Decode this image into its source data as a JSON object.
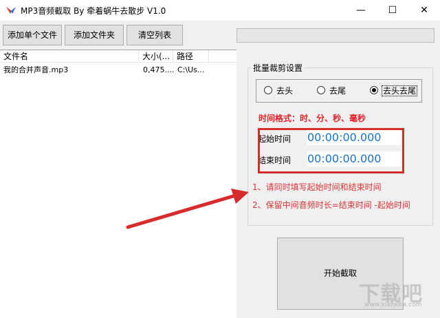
{
  "window": {
    "title": "MP3音频截取 By 牵着蜗牛去散步 V1.0",
    "minimize": "—",
    "maximize": "☐",
    "close": "✕"
  },
  "toolbar": {
    "add_file_label": "添加单个文件",
    "add_folder_label": "添加文件夹",
    "clear_list_label": "清空列表"
  },
  "list": {
    "columns": [
      "文件名",
      "大小(...",
      "路径"
    ],
    "rows": [
      {
        "name": "我的合并声音.mp3",
        "size": "0,475....",
        "path": "C:\\Us..."
      }
    ]
  },
  "batch": {
    "group_title": "批量裁剪设置",
    "options": [
      "去头",
      "去尾",
      "去头去尾"
    ],
    "selected": "去头去尾",
    "format_label": "时间格式：时、分、秒、毫秒",
    "start_label": "起始时间",
    "start_value": "00:00:00.000",
    "end_label": "结束时间",
    "end_value": "00:00:00.000",
    "tip1": "1、请同时填写起始时间和结束时间",
    "tip2": "2、保留中间音频时长=结束时间 -起始时间"
  },
  "start_button_label": "开始截取",
  "watermark": {
    "text": "下载吧",
    "sub": "www.xiazaiba.com"
  },
  "colors": {
    "accent_red": "#d82b2b",
    "time_blue": "#1a73c8"
  }
}
